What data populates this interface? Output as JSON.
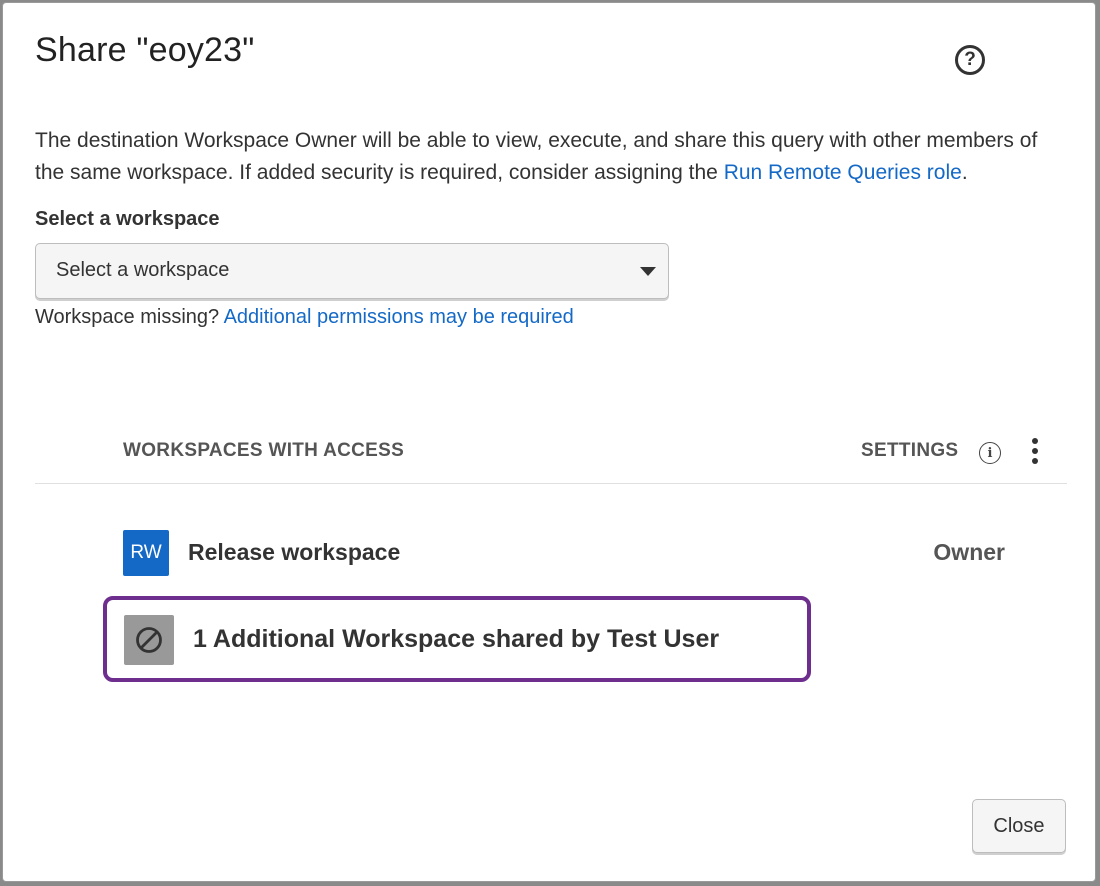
{
  "dialog": {
    "title": "Share \"eoy23\"",
    "help_icon": "question-circle-icon",
    "description": {
      "text": "The destination Workspace Owner will be able to view, execute, and share this query with other members of the same workspace. If added security is required, consider assigning the ",
      "link": "Run Remote Queries role",
      "suffix": "."
    }
  },
  "workspace_select": {
    "label": "Select a workspace",
    "value": "Select a workspace",
    "missing_text": "Workspace missing?",
    "missing_link": "Additional permissions may be required"
  },
  "access_table": {
    "header_workspaces": "WORKSPACES WITH ACCESS",
    "header_settings": "SETTINGS",
    "rows": [
      {
        "avatar": "RW",
        "name": "Release workspace",
        "role": "Owner"
      }
    ],
    "additional": {
      "icon": "blocked-icon",
      "text": "1 Additional Workspace shared by Test User"
    }
  },
  "footer": {
    "close_label": "Close"
  },
  "colors": {
    "link": "#1469c7",
    "avatar_bg": "#1469c7",
    "highlight_border": "#6e2e8e",
    "blocked_icon_bg": "#999999"
  }
}
